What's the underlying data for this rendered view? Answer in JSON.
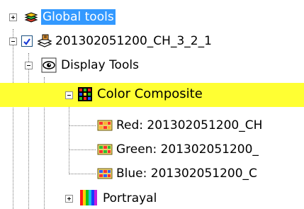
{
  "tree": {
    "items": [
      {
        "label": "Global tools",
        "expander": "plus",
        "icon": "layers-stack-icon"
      },
      {
        "label": "201302051200_CH_3_2_1",
        "expander": "minus",
        "checked": true,
        "icon": "data-layer-icon"
      },
      {
        "label": "Display Tools",
        "expander": "minus",
        "icon": "eye-icon"
      },
      {
        "label": "Color Composite",
        "expander": "minus",
        "icon": "rgb-grid-icon"
      },
      {
        "label": "Red: 201302051200_CH",
        "icon": "raster-band-icon"
      },
      {
        "label": "Green: 201302051200_",
        "icon": "raster-band-icon"
      },
      {
        "label": "Blue: 201302051200_C",
        "icon": "raster-band-icon"
      },
      {
        "label": "Portrayal",
        "expander": "plus",
        "icon": "color-bars-icon"
      }
    ]
  },
  "colors": {
    "selected_row": "#ffff33",
    "label_highlight": "#3399ff",
    "tree_lines": "#7a7a7a"
  }
}
